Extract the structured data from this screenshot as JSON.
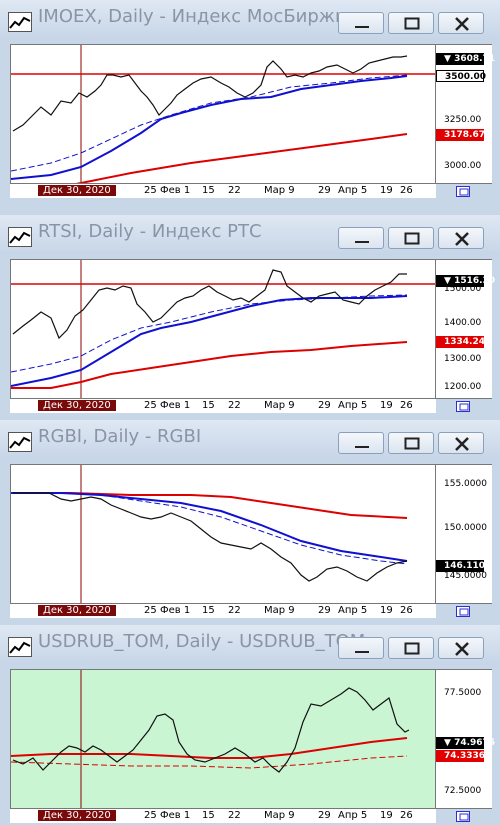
{
  "windows": [
    {
      "id": "imoex",
      "title": "IMOEX, Daily - Индекс МосБиржи",
      "price_labels": [
        "3250.00",
        "3000.00"
      ],
      "badges": [
        {
          "text": "3608.71",
          "style": "black",
          "arrow": true
        },
        {
          "text": "3500.00",
          "style": "white"
        },
        {
          "text": "3178.67",
          "style": "red"
        }
      ],
      "time_labels": [
        "Дек 30, 2020",
        "25",
        "Фев 1",
        "15",
        "22",
        "Мар 9",
        "29",
        "Апр 5",
        "19",
        "26"
      ],
      "colors": {
        "bg": "#ffffff",
        "horizontal_line": "#dd0000",
        "ma_fast": "#1010d0",
        "ma_slow": "#dd0000"
      }
    },
    {
      "id": "rtsi",
      "title": "RTSI, Daily - Индекс РТС",
      "price_labels": [
        "1500.00",
        "1400.00",
        "1300.00",
        "1200.00"
      ],
      "badges": [
        {
          "text": "1516.30",
          "style": "black",
          "arrow": true
        },
        {
          "text": "1334.24",
          "style": "red"
        }
      ],
      "time_labels": [
        "Дек 30, 2020",
        "25",
        "Фев 1",
        "15",
        "22",
        "Мар 9",
        "29",
        "Апр 5",
        "19",
        "26"
      ],
      "colors": {
        "bg": "#ffffff",
        "horizontal_line": "#dd0000",
        "ma_fast": "#1010d0",
        "ma_slow": "#dd0000"
      }
    },
    {
      "id": "rgbi",
      "title": "RGBI, Daily - RGBI",
      "price_labels": [
        "155.0000",
        "150.0000",
        "145.0000"
      ],
      "badges": [
        {
          "text": "146.1100",
          "style": "black",
          "arrow": false
        }
      ],
      "time_labels": [
        "Дек 30, 2020",
        "25",
        "Фев 1",
        "15",
        "22",
        "Мар 9",
        "29",
        "Апр 5",
        "19",
        "26"
      ],
      "colors": {
        "bg": "#ffffff",
        "ma_fast": "#1010d0",
        "ma_slow": "#dd0000"
      }
    },
    {
      "id": "usdrub",
      "title": "USDRUB_TOM, Daily - USDRUB_TOM",
      "price_labels": [
        "77.5000",
        "72.5000"
      ],
      "badges": [
        {
          "text": "74.9675",
          "style": "black",
          "arrow": true
        },
        {
          "text": "74.3336",
          "style": "red"
        }
      ],
      "time_labels": [
        "Дек 30, 2020",
        "25",
        "Фев 1",
        "15",
        "22",
        "Мар 9",
        "29",
        "Апр 5",
        "19",
        "26"
      ],
      "colors": {
        "bg": "#c9f5d3",
        "ma_slow": "#dd0000"
      }
    }
  ],
  "icons": {
    "minimize": "minimize-icon",
    "maximize": "maximize-icon",
    "close": "close-icon",
    "app": "chart-app-icon",
    "scroll": "scroll-to-end-icon"
  }
}
